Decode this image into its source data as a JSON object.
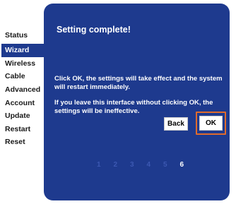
{
  "sidebar": {
    "items": [
      {
        "label": "Status"
      },
      {
        "label": "Wizard"
      },
      {
        "label": "Wireless"
      },
      {
        "label": "Cable"
      },
      {
        "label": "Advanced"
      },
      {
        "label": "Account"
      },
      {
        "label": "Update"
      },
      {
        "label": "Restart"
      },
      {
        "label": "Reset"
      }
    ],
    "active": "Wizard"
  },
  "dialog": {
    "title": "Setting complete!",
    "message1": "Click OK, the settings will take effect and the system will restart immediately.",
    "message2": "If you leave this interface without clicking OK, the settings will be ineffective.",
    "back_label": "Back",
    "ok_label": "OK"
  },
  "wizard_steps": {
    "labels": [
      "1",
      "2",
      "3",
      "4",
      "5",
      "6"
    ],
    "current": "6"
  },
  "colors": {
    "panel_bg": "#1e3a8e",
    "ok_focus_border": "#e06b2c",
    "inactive_step": "#3c58b2"
  }
}
